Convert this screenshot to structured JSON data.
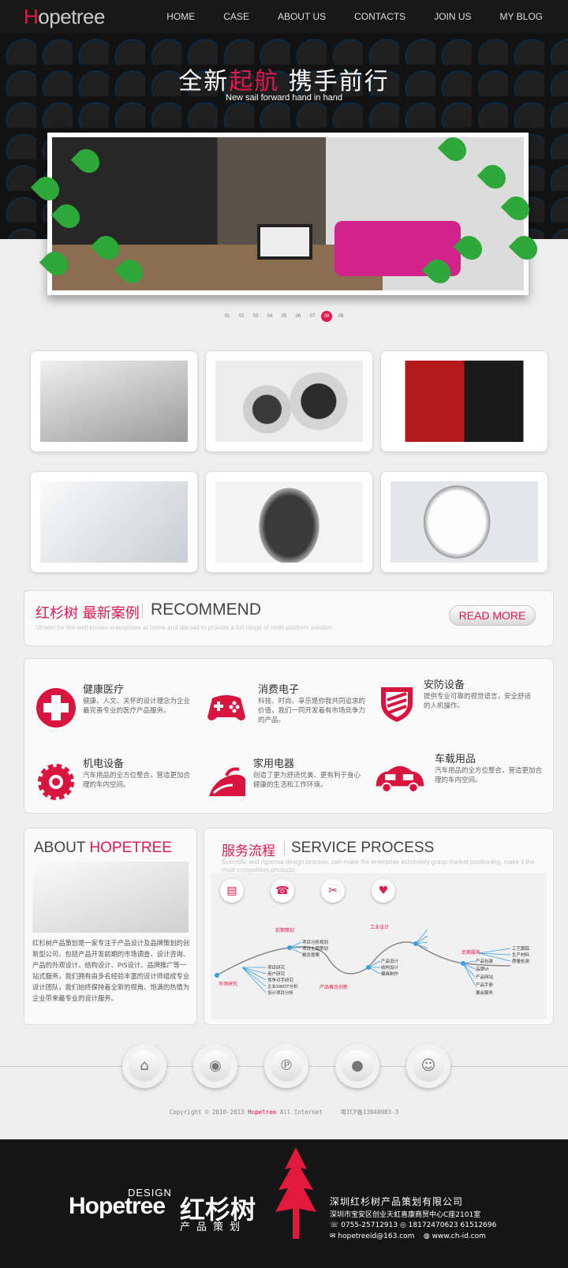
{
  "header": {
    "logo_h": "H",
    "logo_rest": "opetree",
    "nav": [
      "HOME",
      "CASE",
      "ABOUT US",
      "CONTACTS",
      "JOIN US",
      "MY BLOG"
    ]
  },
  "hero": {
    "title_a": "全新",
    "title_b": "起航",
    "title_c": " 携手前行",
    "subtitle": "New sail forward hand in hand",
    "dots": [
      "01",
      "02",
      "03",
      "04",
      "05",
      "06",
      "07",
      "08",
      "09"
    ],
    "active_dot": "08"
  },
  "recommend": {
    "title_cn": "红杉树 最新案例",
    "title_en": "RECOMMEND",
    "desc": "Utmost for the well-known enterprises at home and abroad to provide a full range of multi-platform solution",
    "button": "READ MORE"
  },
  "services": [
    {
      "title": "健康医疗",
      "desc": "健康、人文、关怀的设计理念为企业最完善专业的医疗产品服务。",
      "icon": "medical-cross-icon"
    },
    {
      "title": "消费电子",
      "desc": "科技、时尚、享乐是你我共同追求的价值，我们一同开发着有市场竞争力的产品。",
      "icon": "gamepad-icon"
    },
    {
      "title": "安防设备",
      "desc": "提供专业可靠的视觉语言，安全舒适的人机操作。",
      "icon": "shield-icon"
    },
    {
      "title": "机电设备",
      "desc": "汽车用品的全方位整合，营造更加合理的车内空间。",
      "icon": "gear-icon"
    },
    {
      "title": "家用电器",
      "desc": "创造了更为舒适优美、更有利于身心健康的生活和工作环境。",
      "icon": "iron-icon"
    },
    {
      "title": "车载用品",
      "desc": "汽车用品的全方位整合，营造更加合理的车内空间。",
      "icon": "car-icon"
    }
  ],
  "about": {
    "title_a": "ABOUT",
    "title_b": "HOPETREE",
    "text": "红杉树产品策划是一家专注于产品设计及品牌策划的创新型公司。包括产品开发前期的市场调查、设计咨询、产品的外观设计、结构设计、PIS设计、品牌推广等一站式服务。我们拥有由多名经验丰富的设计师组成专业设计团队，我们始终保持着全新的视角、饱满的热情为企业带来最专业的设计服务。"
  },
  "process": {
    "title_cn": "服务流程",
    "title_en": "SERVICE PROCESS",
    "desc": "Scientific and rigorous design process, can make the enterprise accurately grasp market positioning, make it the most competitive products",
    "buttons": [
      "card-icon",
      "phone-icon",
      "scissors-icon",
      "heart-icon"
    ],
    "nodes": [
      {
        "label": "前期策划",
        "red": true
      },
      {
        "label": "工业设计",
        "red": true
      },
      {
        "label": "市场研究",
        "red": true
      },
      {
        "label": "产品概念创新",
        "red": true
      },
      {
        "label": "后期服务",
        "red": true
      },
      {
        "label": "项目分析规划",
        "red": false
      },
      {
        "label": "项目主题策划",
        "red": false
      },
      {
        "label": "概念提案",
        "red": false
      },
      {
        "label": "项目研究",
        "red": false
      },
      {
        "label": "用户研究",
        "red": false
      },
      {
        "label": "竞争对手研究",
        "red": false
      },
      {
        "label": "企业SWOT分析",
        "red": false
      },
      {
        "label": "设计项目分析",
        "red": false
      },
      {
        "label": "产品设计",
        "red": false
      },
      {
        "label": "结构设计",
        "red": false
      },
      {
        "label": "模具制作",
        "red": false
      },
      {
        "label": "工艺跟踪",
        "red": false
      },
      {
        "label": "生产材料",
        "red": false
      },
      {
        "label": "质量检测",
        "red": false
      },
      {
        "label": "产品包装",
        "red": false
      },
      {
        "label": "品牌VI",
        "red": false
      },
      {
        "label": "产品网站",
        "red": false
      },
      {
        "label": "产品手册",
        "red": false
      },
      {
        "label": "展会服务",
        "red": false
      }
    ]
  },
  "social": [
    "home-icon",
    "weibo-icon",
    "pinterest-icon",
    "qq-weibo-icon",
    "contact-icon"
  ],
  "copyright": {
    "a": "Copyright © 2010-2013 ",
    "b": "Hopetree",
    "c": " All Internet",
    "icp": "粤ICP备13040983-3"
  },
  "footer": {
    "design": "DESIGN",
    "brand": "Hopetree",
    "brand_cn": "红杉树",
    "sub_cn": "产品策划",
    "company": "深圳红杉树产品策划有限公司",
    "address": "深圳市宝安区创业天虹喜康商贸中心C座2101室",
    "phone": "0755-25712913",
    "mobile": "18172470623",
    "qq": "61512696",
    "email": "hopetreeid@163.com",
    "website": "www.ch-id.com"
  }
}
